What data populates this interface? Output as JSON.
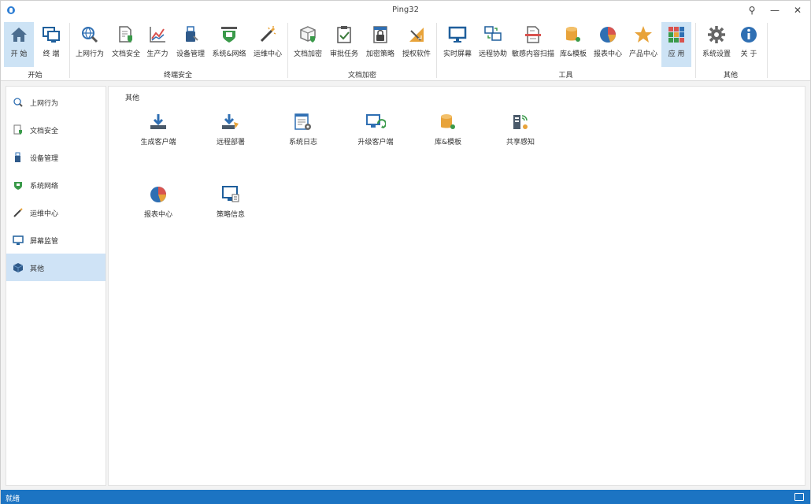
{
  "window": {
    "title": "Ping32"
  },
  "titlebar": {
    "search_glyph": "⚲",
    "minimize_glyph": "—",
    "close_glyph": "✕"
  },
  "ribbon": {
    "groups": [
      {
        "label": "开始"
      },
      {
        "label": "终端安全"
      },
      {
        "label": "文档加密"
      },
      {
        "label": "工具"
      },
      {
        "label": "其他"
      }
    ],
    "buttons": [
      {
        "label": "开 始",
        "icon": "home-icon"
      },
      {
        "label": "终 端",
        "icon": "terminal-icon"
      },
      {
        "label": "上网行为",
        "icon": "globe-search-icon"
      },
      {
        "label": "文档安全",
        "icon": "document-shield-icon"
      },
      {
        "label": "生产力",
        "icon": "chart-line-icon"
      },
      {
        "label": "设备管理",
        "icon": "usb-device-icon"
      },
      {
        "label": "系统&网络",
        "icon": "network-shield-icon"
      },
      {
        "label": "运维中心",
        "icon": "magic-wand-icon"
      },
      {
        "label": "文档加密",
        "icon": "cube-shield-icon"
      },
      {
        "label": "审批任务",
        "icon": "clipboard-check-icon"
      },
      {
        "label": "加密策略",
        "icon": "lock-policy-icon"
      },
      {
        "label": "授权软件",
        "icon": "ruler-tools-icon"
      },
      {
        "label": "实时屏幕",
        "icon": "monitor-icon"
      },
      {
        "label": "远程协助",
        "icon": "remote-assist-icon"
      },
      {
        "label": "敏感内容扫描",
        "icon": "document-scan-icon"
      },
      {
        "label": "库&模板",
        "icon": "database-icon"
      },
      {
        "label": "报表中心",
        "icon": "pie-chart-icon"
      },
      {
        "label": "产品中心",
        "icon": "star-icon"
      },
      {
        "label": "应 用",
        "icon": "apps-grid-icon"
      },
      {
        "label": "系统设置",
        "icon": "gear-icon"
      },
      {
        "label": "关 于",
        "icon": "info-icon"
      }
    ]
  },
  "sidebar": {
    "items": [
      {
        "label": "上网行为",
        "icon": "globe-search-icon"
      },
      {
        "label": "文档安全",
        "icon": "document-shield-icon"
      },
      {
        "label": "设备管理",
        "icon": "usb-device-icon"
      },
      {
        "label": "系统网络",
        "icon": "network-shield-icon"
      },
      {
        "label": "运维中心",
        "icon": "magic-wand-icon"
      },
      {
        "label": "屏幕监管",
        "icon": "monitor-icon"
      },
      {
        "label": "其他",
        "icon": "cube-icon"
      }
    ],
    "active_index": 6
  },
  "main": {
    "section_title": "其他",
    "tiles": [
      {
        "label": "生成客户端",
        "icon": "download-tray-icon"
      },
      {
        "label": "远程部署",
        "icon": "deploy-icon"
      },
      {
        "label": "系统日志",
        "icon": "log-icon"
      },
      {
        "label": "升级客户端",
        "icon": "upgrade-client-icon"
      },
      {
        "label": "库&模板",
        "icon": "database-icon"
      },
      {
        "label": "共享感知",
        "icon": "share-sensor-icon"
      },
      {
        "label": "报表中心",
        "icon": "pie-chart-icon"
      },
      {
        "label": "策略信息",
        "icon": "policy-monitor-icon"
      }
    ]
  },
  "statusbar": {
    "text": "就绪"
  },
  "colors": {
    "accent": "#1c74c3",
    "selected": "#cde3f5"
  }
}
